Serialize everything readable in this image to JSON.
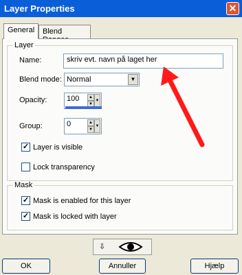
{
  "window": {
    "title": "Layer Properties",
    "close_glyph": "✕"
  },
  "tabs": [
    {
      "label": "General",
      "active": true
    },
    {
      "label": "Blend Ranges",
      "active": false
    }
  ],
  "layer_group": {
    "legend": "Layer",
    "name_label": "Name:",
    "name_value": "skriv evt. navn på laget her",
    "blend_label": "Blend mode:",
    "blend_value": "Normal",
    "opacity_label": "Opacity:",
    "opacity_value": "100",
    "opacity_fraction": 1.0,
    "group_label": "Group:",
    "group_value": "0",
    "visible_label": "Layer is visible",
    "visible_checked": true,
    "lock_label": "Lock transparency",
    "lock_checked": false
  },
  "mask_group": {
    "legend": "Mask",
    "enabled_label": "Mask is enabled for this layer",
    "enabled_checked": true,
    "locked_label": "Mask is locked with layer",
    "locked_checked": true
  },
  "toolbar": {
    "pin_glyph": "⇩",
    "eye_icon": "eye-icon"
  },
  "buttons": {
    "ok": "OK",
    "cancel": "Annuller",
    "help": "Hjælp"
  },
  "annotation": {
    "arrow_color": "#ff1a1a"
  }
}
